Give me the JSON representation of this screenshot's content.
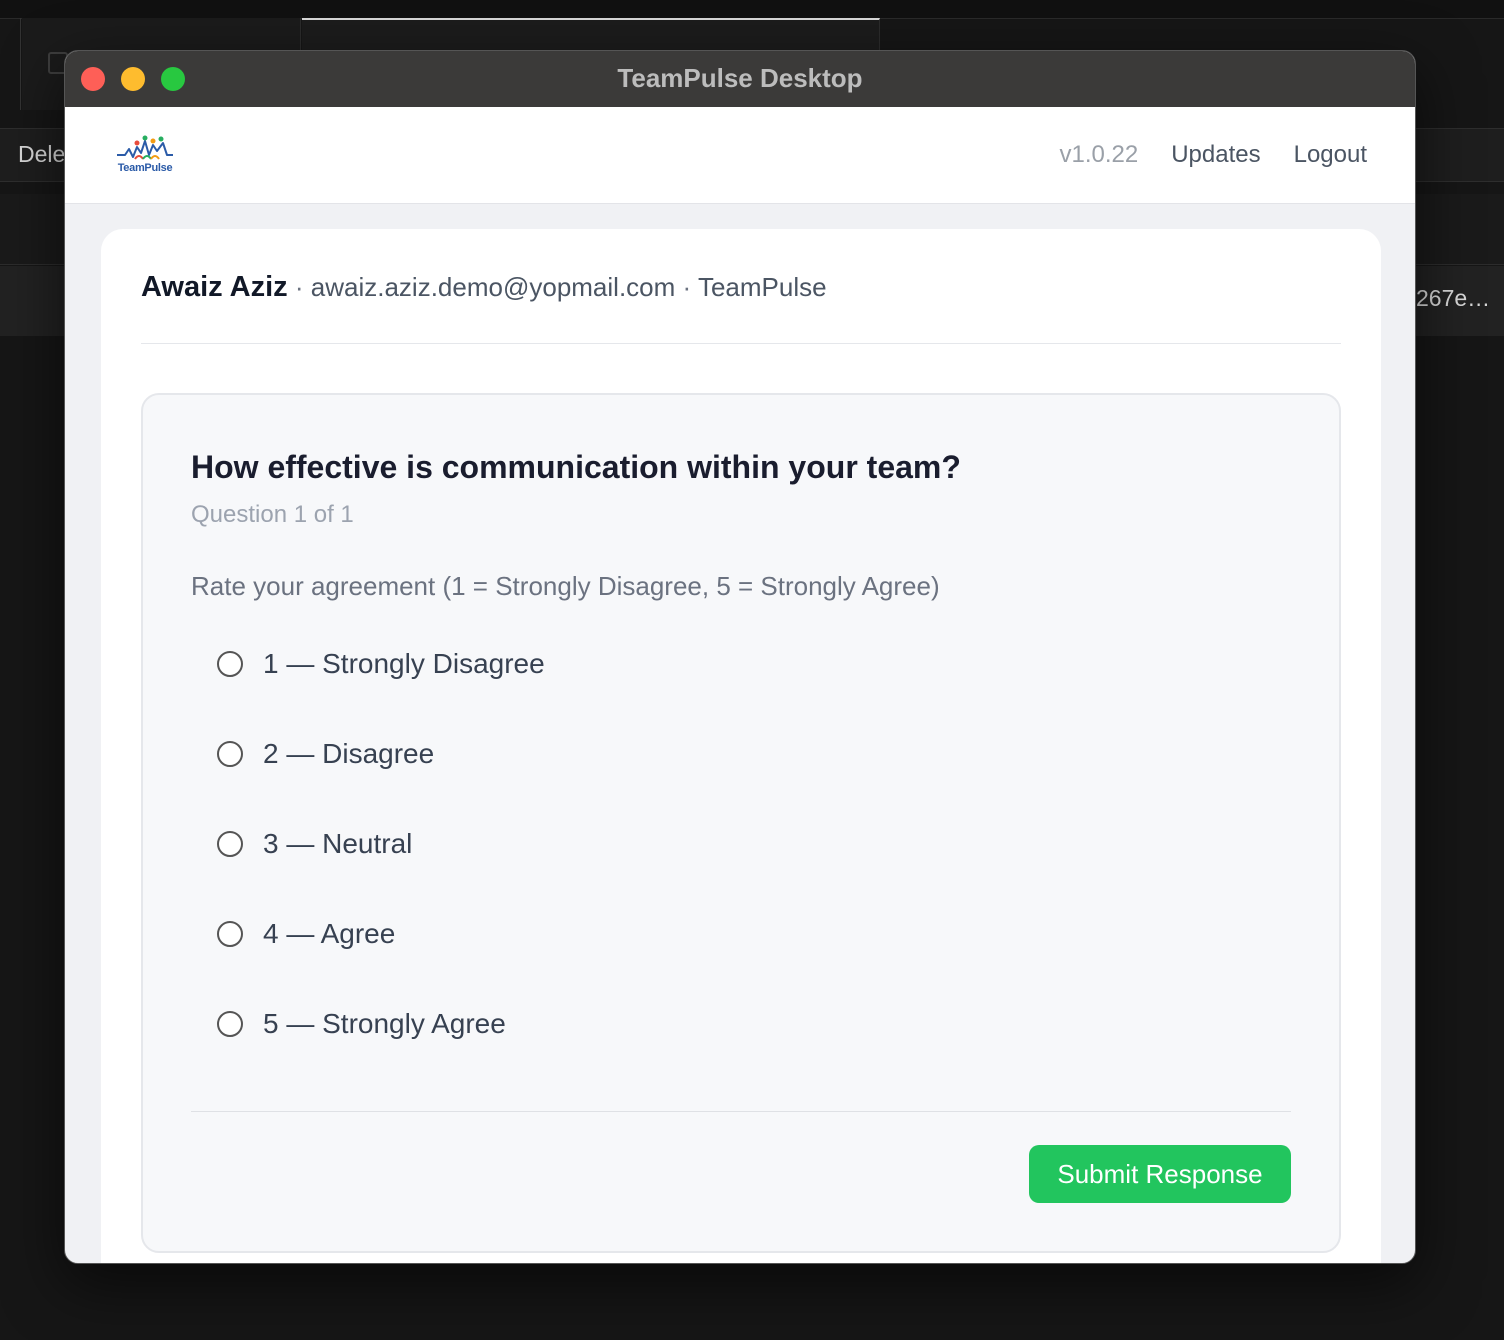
{
  "background": {
    "left_text": "Dele",
    "right_text": "267e…"
  },
  "window": {
    "title": "TeamPulse Desktop"
  },
  "header": {
    "logo_text": "TeamPulse",
    "version": "v1.0.22",
    "updates_label": "Updates",
    "logout_label": "Logout"
  },
  "user": {
    "name": "Awaiz Aziz",
    "separator": " · ",
    "email": "awaiz.aziz.demo@yopmail.com",
    "org": "TeamPulse"
  },
  "survey": {
    "question": "How effective is communication within your team?",
    "progress": "Question 1 of 1",
    "prompt": "Rate your agreement (1 = Strongly Disagree, 5 = Strongly Agree)",
    "options": [
      {
        "label": "1 — Strongly Disagree",
        "selected": false
      },
      {
        "label": "2 — Disagree",
        "selected": false
      },
      {
        "label": "3 — Neutral",
        "selected": false
      },
      {
        "label": "4 — Agree",
        "selected": false
      },
      {
        "label": "5 — Strongly Agree",
        "selected": false
      }
    ],
    "submit_label": "Submit Response"
  },
  "colors": {
    "accent_green": "#22c55e",
    "traffic_close": "#fe5f57",
    "traffic_min": "#febc2e",
    "traffic_max": "#28c840"
  }
}
